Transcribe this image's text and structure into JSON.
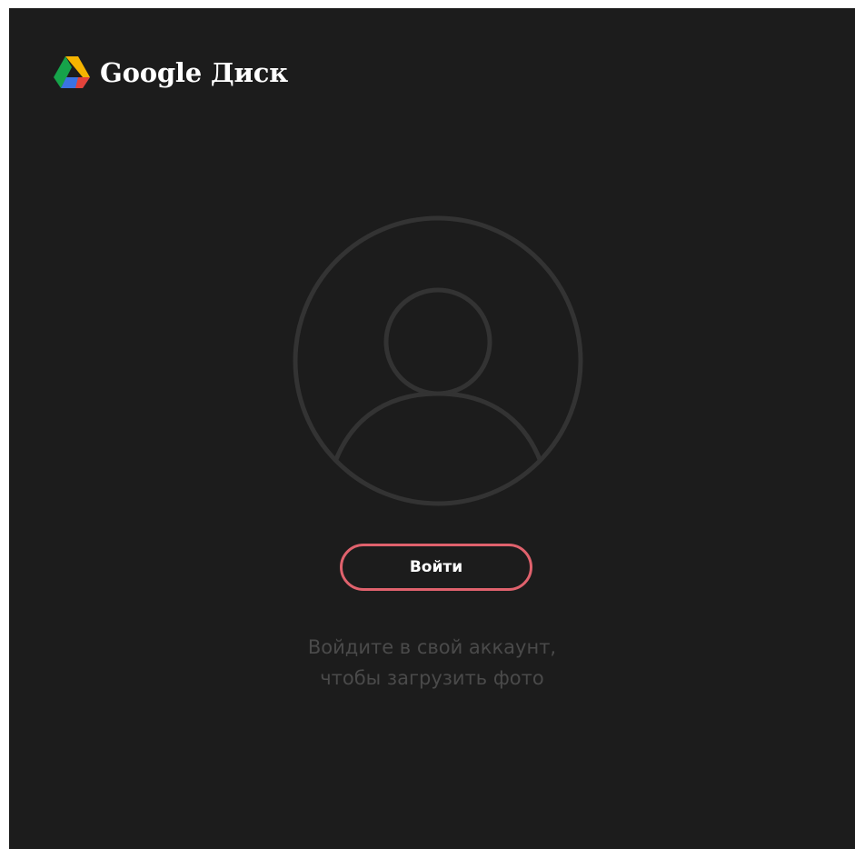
{
  "app": {
    "title": "Google Диск",
    "logo_icon": "google-drive-icon"
  },
  "avatar": {
    "icon": "user-avatar-icon",
    "stroke_color": "#333333"
  },
  "signin": {
    "label": "Войти",
    "border_color": "#e0626d"
  },
  "hint": {
    "line1": "Войдите в свой аккаунт,",
    "line2": "чтобы загрузить фото"
  },
  "colors": {
    "background": "#1c1c1c",
    "text_primary": "#ffffff",
    "text_muted": "#4a4a4a"
  }
}
